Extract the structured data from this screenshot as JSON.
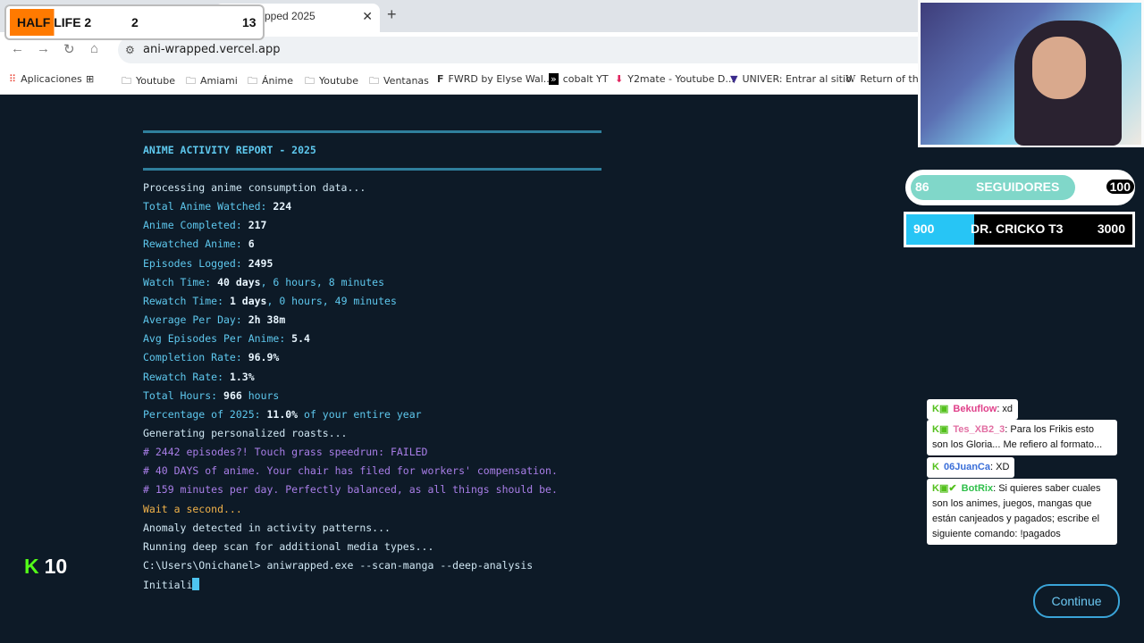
{
  "browser": {
    "tab_title": "pped 2025",
    "tab_close": "✕",
    "new_tab": "+",
    "nav": {
      "back": "←",
      "forward": "→",
      "reload": "↻",
      "home": "⌂"
    },
    "url": "ani-wrapped.vercel.app",
    "bookmarks": [
      {
        "label": "Aplicaciones",
        "icon": "apps-grid-icon"
      },
      {
        "label": "",
        "icon": "grid-icon"
      },
      {
        "label": "Youtube",
        "icon": "folder-icon"
      },
      {
        "label": "Amiami",
        "icon": "folder-icon"
      },
      {
        "label": "Ánime",
        "icon": "folder-icon"
      },
      {
        "label": "Youtube",
        "icon": "folder-icon"
      },
      {
        "label": "Ventanas",
        "icon": "folder-icon"
      },
      {
        "label": "FWRD by Elyse Wal...",
        "icon": "f-logo-icon"
      },
      {
        "label": "cobalt YT",
        "icon": "cobalt-icon"
      },
      {
        "label": "Y2mate - Youtube D...",
        "icon": "download-icon"
      },
      {
        "label": "UNIVER: Entrar al sitio",
        "icon": "univer-icon"
      },
      {
        "label": "Return of the",
        "icon": "wiki-icon"
      }
    ]
  },
  "report": {
    "title": "ANIME ACTIVITY REPORT - 2025",
    "processing": "Processing anime consumption data...",
    "stats": [
      {
        "label": "Total Anime Watched: ",
        "value": "224",
        "suffix": ""
      },
      {
        "label": "Anime Completed: ",
        "value": "217",
        "suffix": ""
      },
      {
        "label": "Rewatched Anime: ",
        "value": "6",
        "suffix": ""
      },
      {
        "label": "Episodes Logged: ",
        "value": "2495",
        "suffix": ""
      },
      {
        "label": "Watch Time: ",
        "value": "40 days",
        "suffix": ", 6 hours, 8 minutes"
      },
      {
        "label": "Rewatch Time: ",
        "value": "1 days",
        "suffix": ", 0 hours, 49 minutes"
      },
      {
        "label": "Average Per Day: ",
        "value": "2h 38m",
        "suffix": ""
      },
      {
        "label": "Avg Episodes Per Anime: ",
        "value": "5.4",
        "suffix": ""
      },
      {
        "label": "Completion Rate: ",
        "value": "96.9%",
        "suffix": ""
      },
      {
        "label": "Rewatch Rate: ",
        "value": "1.3%",
        "suffix": ""
      },
      {
        "label": "Total Hours: ",
        "value": "966",
        "suffix": " hours"
      },
      {
        "label": "Percentage of 2025: ",
        "value": "11.0%",
        "suffix": " of your entire year"
      }
    ],
    "generating": "Generating personalized roasts...",
    "roasts": [
      "# 2442 episodes?! Touch grass speedrun: FAILED",
      "# 40 DAYS of anime. Your chair has filed for workers' compensation.",
      "# 159 minutes per day. Perfectly balanced, as all things should be."
    ],
    "wait": "Wait a second...",
    "anomaly": "Anomaly detected in activity patterns...",
    "deep_scan": "Running deep scan for additional media types...",
    "command": "C:\\Users\\Onichanel> aniwrapped.exe --scan-manga --deep-analysis",
    "typing": "Initiali"
  },
  "continue_label": "Continue",
  "overlay": {
    "game_title": "HALF LIFE 2",
    "game_left": "2",
    "game_right": "13",
    "followers": {
      "current": "86",
      "label": "SEGUIDORES",
      "goal": "100",
      "progress": 0.86
    },
    "goal2": {
      "current": "900",
      "label": "DR. CRICKO T3",
      "goal": "3000",
      "progress": 0.3
    },
    "kick_count": "10",
    "chat": [
      {
        "user": "Bekuflow",
        "user_color": "#e0408a",
        "message": ": xd"
      },
      {
        "user": "Tes_XB2_3",
        "user_color": "#e26fa3",
        "message": ": Para los Frikis esto son los Gloria... Me refiero al formato..."
      },
      {
        "user": "06JuanCa",
        "user_color": "#3b6fd8",
        "message": ": XD"
      },
      {
        "user": "BotRix",
        "user_color": "#2fbf4a",
        "message": ": Si quieres saber cuales son los animes, juegos, mangas que están canjeados y pagados; escribe el siguiente comando: !pagados"
      }
    ]
  }
}
